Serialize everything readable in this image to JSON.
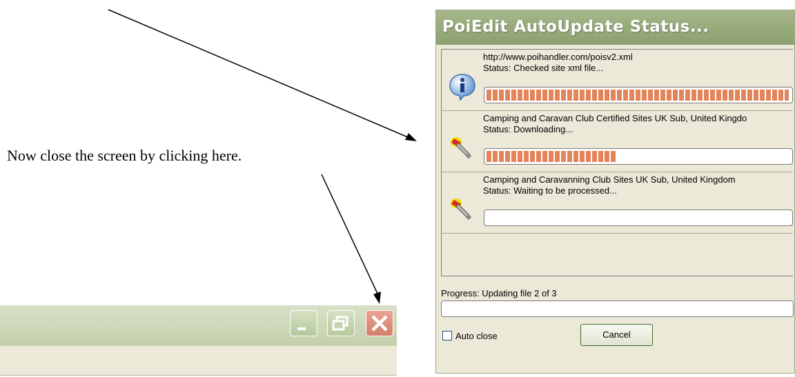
{
  "instruction_text": "Now close the screen by clicking here.",
  "dialog": {
    "title": "PoiEdit AutoUpdate Status...",
    "items": [
      {
        "line1": "http://www.poihandler.com/poisv2.xml",
        "line2": "Status: Checked site xml file...",
        "progress": 1.0,
        "icon": "info-icon"
      },
      {
        "line1": "Camping and Caravan Club Certified Sites UK Sub, United Kingdo",
        "line2": "Status: Downloading...",
        "progress": 0.43,
        "icon": "plug-icon"
      },
      {
        "line1": "Camping  and Caravanning Club Sites UK Sub, United Kingdom",
        "line2": "Status: Waiting to be processed...",
        "progress": 0.0,
        "icon": "plug-icon"
      }
    ],
    "progress_label": "Progress: Updating file 2 of 3",
    "auto_close_label": "Auto close",
    "auto_close_checked": false,
    "cancel_label": "Cancel"
  },
  "window_controls": {
    "minimize": "minimize-icon",
    "maximize": "restore-icon",
    "close": "close-icon"
  },
  "colors": {
    "progress_fill": "#e3835a",
    "title_bar": "#98ab7b",
    "dialog_bg": "#ece9d8"
  }
}
